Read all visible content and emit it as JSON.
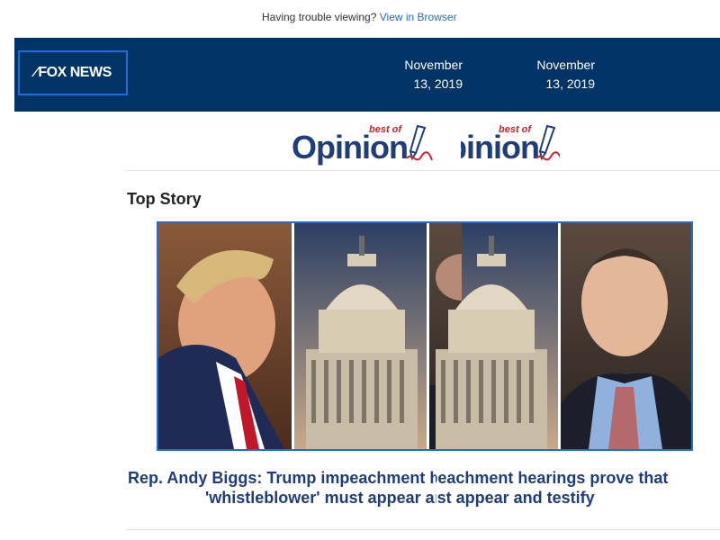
{
  "preheader": {
    "text": "Having trouble viewing?",
    "link": "View in Browser"
  },
  "header": {
    "logo_text": "FOX NEWS",
    "date": "November 13, 2019"
  },
  "banner": {
    "best_of": "best of",
    "title": "Opinion"
  },
  "section": {
    "title": "Top Story"
  },
  "story": {
    "headline_line1": "Rep. Andy Biggs: Trump impeachment hearings prove that",
    "headline_line2": "'whistleblower' must appear and testify"
  },
  "colors": {
    "header_bg": "#003366",
    "link": "#2a6bb3",
    "headline": "#1f3d7a",
    "accent_red": "#d0202a",
    "logo_border": "#1f6fd1"
  }
}
